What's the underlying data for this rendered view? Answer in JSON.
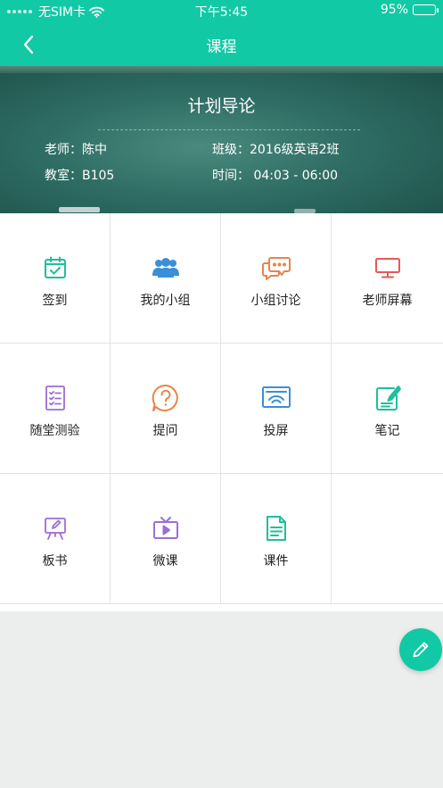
{
  "status_bar": {
    "carrier": "无SIM卡",
    "time": "下午5:45",
    "battery": "95%",
    "battery_level": 0.95
  },
  "nav": {
    "title": "课程"
  },
  "course": {
    "name": "计划导论",
    "teacher": "老师：陈中",
    "class": "班级：2016级英语2班",
    "room": "教室：B105",
    "time": "时间：  04:03 - 06:00"
  },
  "features": [
    {
      "label": "签到",
      "icon": "calendar-check-icon",
      "color": "#1fbf9c"
    },
    {
      "label": "我的小组",
      "icon": "group-icon",
      "color": "#3a8fd6"
    },
    {
      "label": "小组讨论",
      "icon": "chat-bubbles-icon",
      "color": "#e8844a"
    },
    {
      "label": "老师屏幕",
      "icon": "monitor-icon",
      "color": "#e25a5a"
    },
    {
      "label": "随堂测验",
      "icon": "checklist-icon",
      "color": "#9a6fd6"
    },
    {
      "label": "提问",
      "icon": "question-icon",
      "color": "#e8844a"
    },
    {
      "label": "投屏",
      "icon": "cast-screen-icon",
      "color": "#3a8fd6"
    },
    {
      "label": "笔记",
      "icon": "note-edit-icon",
      "color": "#1fbf9c"
    },
    {
      "label": "板书",
      "icon": "board-icon",
      "color": "#9a6fd6"
    },
    {
      "label": "微课",
      "icon": "tv-play-icon",
      "color": "#9a6fd6"
    },
    {
      "label": "课件",
      "icon": "document-icon",
      "color": "#1fbf9c"
    }
  ],
  "colors": {
    "primary": "#12c9a6"
  }
}
